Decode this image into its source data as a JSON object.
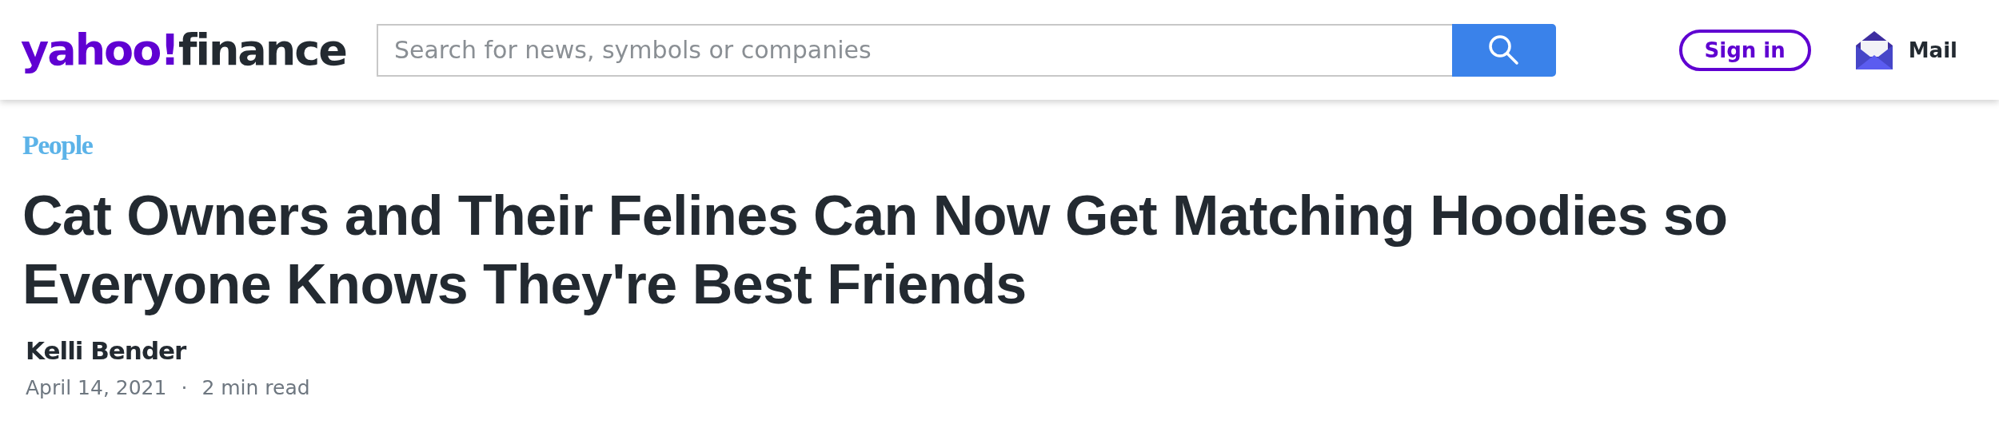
{
  "header": {
    "logo": {
      "brand": "yahoo!",
      "section": "finance"
    },
    "search": {
      "placeholder": "Search for news, symbols or companies"
    },
    "sign_in": "Sign in",
    "mail": "Mail"
  },
  "article": {
    "source": "People",
    "headline": "Cat Owners and Their Felines Can Now Get Matching Hoodies so Everyone Knows They're Best Friends",
    "author": "Kelli Bender",
    "date": "April 14, 2021",
    "separator": "·",
    "read_time": "2 min read"
  }
}
